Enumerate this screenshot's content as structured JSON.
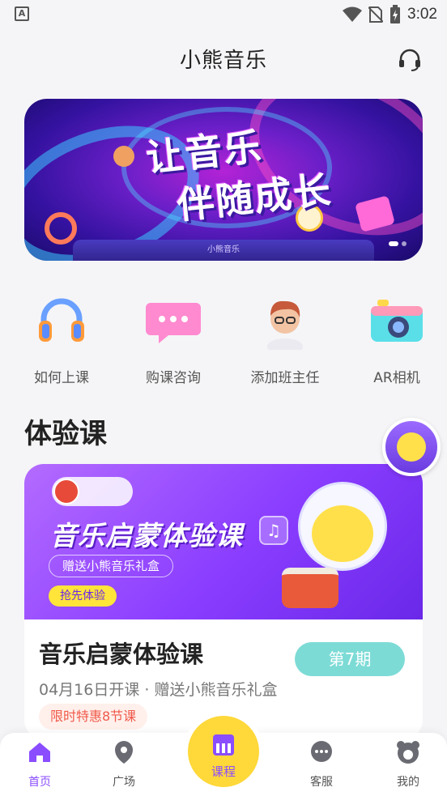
{
  "status_bar": {
    "time": "3:02"
  },
  "header": {
    "title": "小熊音乐"
  },
  "banner": {
    "line1": "让音乐",
    "line2": "伴随成长",
    "logo_text": "小熊音乐"
  },
  "quick_menu": [
    {
      "label": "如何上课",
      "icon": "headphones-icon"
    },
    {
      "label": "购课咨询",
      "icon": "chat-bubble-icon"
    },
    {
      "label": "添加班主任",
      "icon": "teacher-avatar-icon"
    },
    {
      "label": "AR相机",
      "icon": "camera-icon"
    }
  ],
  "section": {
    "title": "体验课"
  },
  "course_card": {
    "banner_title": "音乐启蒙体验课",
    "banner_gift": "赠送小熊音乐礼盒",
    "banner_button": "抢先体验",
    "note_glyph": "♫",
    "name": "音乐启蒙体验课",
    "period": "第7期",
    "meta": "04月16日开课 · 赠送小熊音乐礼盒",
    "tag": "限时特惠8节课"
  },
  "tab_bar": {
    "home": "首页",
    "plaza": "广场",
    "course": "课程",
    "service": "客服",
    "mine": "我的"
  },
  "colors": {
    "accent": "#8a4dff",
    "center_tab": "#ffd83a",
    "badge": "#7ddbd6"
  }
}
